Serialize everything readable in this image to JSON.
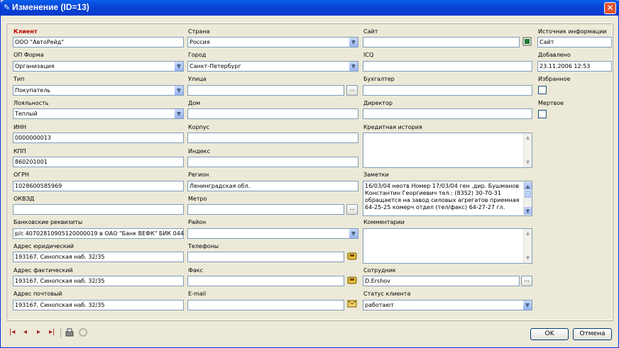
{
  "window": {
    "title": "Изменение (ID=13)",
    "close": "✕"
  },
  "col1": {
    "client_label": "Клиент",
    "client_value": "ООО \"АвтоРейд\"",
    "opf_label": "ОП Форма",
    "opf_value": "Организация",
    "type_label": "Тип",
    "type_value": "Покупатель",
    "loyalty_label": "Лояльность",
    "loyalty_value": "Теплый",
    "inn_label": "ИНН",
    "inn_value": "0000000013",
    "kpp_label": "КПП",
    "kpp_value": "860201001",
    "ogrn_label": "ОГРН",
    "ogrn_value": "1028600585969",
    "okved_label": "ОКВЭД",
    "okved_value": "",
    "bank_label": "Банковские реквизиты",
    "bank_value": "р/с 40702810905120000019 в ОАО \"Банк ВЕФК\" БИК 044",
    "addr_legal_label": "Адрес юридический",
    "addr_legal_value": "193167, Синопская наб. 32/35",
    "addr_fact_label": "Адрес фактический",
    "addr_fact_value": "193167, Синопская наб. 32/35",
    "addr_post_label": "Адрес почтовый",
    "addr_post_value": "193167, Синопская наб. 32/35"
  },
  "col2": {
    "country_label": "Страна",
    "country_value": "Россия",
    "city_label": "Город",
    "city_value": "Санкт-Петербург",
    "street_label": "Улица",
    "street_value": "",
    "house_label": "Дом",
    "house_value": "",
    "building_label": "Корпус",
    "building_value": "",
    "index_label": "Индекс",
    "index_value": "",
    "region_label": "Регион",
    "region_value": "Ленинградская обл.",
    "metro_label": "Метро",
    "metro_value": "",
    "district_label": "Район",
    "district_value": "",
    "phones_label": "Телефоны",
    "phones_value": "",
    "fax_label": "Факс",
    "fax_value": "",
    "email_label": "E-mail",
    "email_value": ""
  },
  "col3": {
    "site_label": "Сайт",
    "site_value": "",
    "icq_label": "ICQ",
    "icq_value": "",
    "accountant_label": "Бухгалтер",
    "accountant_value": "",
    "director_label": "Директор",
    "director_value": "",
    "credit_label": "Кредитная история",
    "credit_value": "",
    "notes_label": "Заметки",
    "notes_value": "16/03/04 неотв Номер 17/03/04 ген .дир. Бушманов Константин Георгиевич тел.: (8352) 30-70-31 обращается на завод силовых агрегатов приемная 64-25-25 комерч отдел (тел/факс) 64-27-27 гл.",
    "comments_label": "Комментарии",
    "comments_value": "",
    "employee_label": "Сотрудник",
    "employee_value": "D.Ershov",
    "status_label": "Статус клиента",
    "status_value": "работают"
  },
  "col4": {
    "source_label": "Источник информации",
    "source_value": "Сайт",
    "added_label": "Добавлено",
    "added_value": "23.11.2006 12:53",
    "favorite_label": "Избранное",
    "dead_label": "Мертвое"
  },
  "buttons": {
    "ok": "OK",
    "cancel": "Отмена",
    "browse": "...",
    "dropdown": "▼"
  },
  "nav": {
    "first": "|◂",
    "prev": "◂",
    "next": "▸",
    "last": "▸|"
  }
}
